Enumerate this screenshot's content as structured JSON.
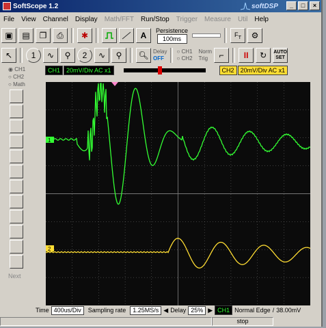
{
  "window": {
    "title": "SoftScope 1.2",
    "brand": "softDSP"
  },
  "menu": [
    "File",
    "View",
    "Channel",
    "Display",
    "Math/FFT",
    "Run/Stop",
    "Trigger",
    "Measure",
    "Util",
    "Help"
  ],
  "menu_disabled": [
    false,
    false,
    false,
    false,
    true,
    false,
    true,
    true,
    true,
    false
  ],
  "toolbar": {
    "persistence_label": "Persistence",
    "persistence_value": "100ms",
    "zoom_label": "Zoom",
    "delay_label": "Delay",
    "delay_state": "OFF",
    "ch1_label": "CH1",
    "ch2_label": "CH2",
    "norm_label": "Norm",
    "trig_label": "Trig",
    "auto_label": "AUTO",
    "set_label": "SET"
  },
  "side": {
    "ch1": "CH1",
    "ch2": "CH2",
    "math": "Math",
    "next": "Next"
  },
  "strip": {
    "ch1": "CH1",
    "ch1_scale": "20mV/Div AC x1",
    "ch2": "CH2",
    "ch2_scale": "20mV/Div AC x1"
  },
  "bottom": {
    "time_label": "Time",
    "time_value": "400us/Div",
    "sampling_label": "Sampling rate",
    "sampling_value": "1.25MS/s",
    "delay_label": "Delay",
    "delay_value": "25%",
    "trigger_ch": "CH1",
    "trigger_mode": "Normal Edge",
    "trigger_level": "38.00mV"
  },
  "statusbar": {
    "state": "stop"
  },
  "colors": {
    "ch1": "#33ff33",
    "ch2": "#ffdd33",
    "grid": "#777777"
  },
  "markers": {
    "ch1": "1",
    "ch2": "2"
  }
}
